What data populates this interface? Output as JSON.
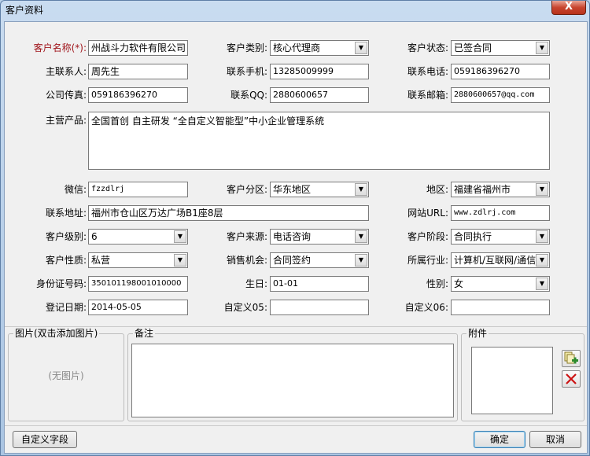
{
  "window": {
    "title": "客户资料",
    "close_label": "X"
  },
  "fields": {
    "customer_name": {
      "label": "客户名称(*):",
      "value": "州战斗力软件有限公司"
    },
    "customer_type": {
      "label": "客户类别:",
      "value": "核心代理商"
    },
    "customer_status": {
      "label": "客户状态:",
      "value": "已签合同"
    },
    "main_contact": {
      "label": "主联系人:",
      "value": "周先生"
    },
    "mobile": {
      "label": "联系手机:",
      "value": "13285009999"
    },
    "phone": {
      "label": "联系电话:",
      "value": "059186396270"
    },
    "fax": {
      "label": "公司传真:",
      "value": "059186396270"
    },
    "qq": {
      "label": "联系QQ:",
      "value": "2880600657"
    },
    "email": {
      "label": "联系邮箱:",
      "value": "2880600657@qq.com"
    },
    "main_products": {
      "label": "主营产品:",
      "value": "全国首创 自主研发 “全自定义智能型”中小企业管理系统"
    },
    "wechat": {
      "label": "微信:",
      "value": "fzzdlrj"
    },
    "region_division": {
      "label": "客户分区:",
      "value": "华东地区"
    },
    "area": {
      "label": "地区:",
      "value": "福建省福州市"
    },
    "address": {
      "label": "联系地址:",
      "value": "福州市仓山区万达广场B1座8层"
    },
    "website": {
      "label": "网站URL:",
      "value": "www.zdlrj.com"
    },
    "level": {
      "label": "客户级别:",
      "value": "6"
    },
    "source": {
      "label": "客户来源:",
      "value": "电话咨询"
    },
    "stage": {
      "label": "客户阶段:",
      "value": "合同执行"
    },
    "nature": {
      "label": "客户性质:",
      "value": "私营"
    },
    "opportunity": {
      "label": "销售机会:",
      "value": "合同签约"
    },
    "industry": {
      "label": "所属行业:",
      "value": "计算机/互联网/通信"
    },
    "id_number": {
      "label": "身份证号码:",
      "value": "350101198001010000"
    },
    "birthday": {
      "label": "生日:",
      "value": "01-01"
    },
    "gender": {
      "label": "性别:",
      "value": "女"
    },
    "register_date": {
      "label": "登记日期:",
      "value": "2014-05-05"
    },
    "custom05": {
      "label": "自定义05:",
      "value": ""
    },
    "custom06": {
      "label": "自定义06:",
      "value": ""
    }
  },
  "picture_group": {
    "title": "图片(双击添加图片)",
    "empty_text": "(无图片)"
  },
  "remarks_group": {
    "title": "备注"
  },
  "attachments_group": {
    "title": "附件",
    "add_icon": "add-attachment-icon",
    "delete_icon": "delete-attachment-icon"
  },
  "footer": {
    "custom_fields_label": "自定义字段",
    "ok_label": "确定",
    "cancel_label": "取消"
  },
  "colors": {
    "required_label": "#a0151b",
    "delete_icon": "#cc1111",
    "add_icon": "#2e8b2e"
  }
}
